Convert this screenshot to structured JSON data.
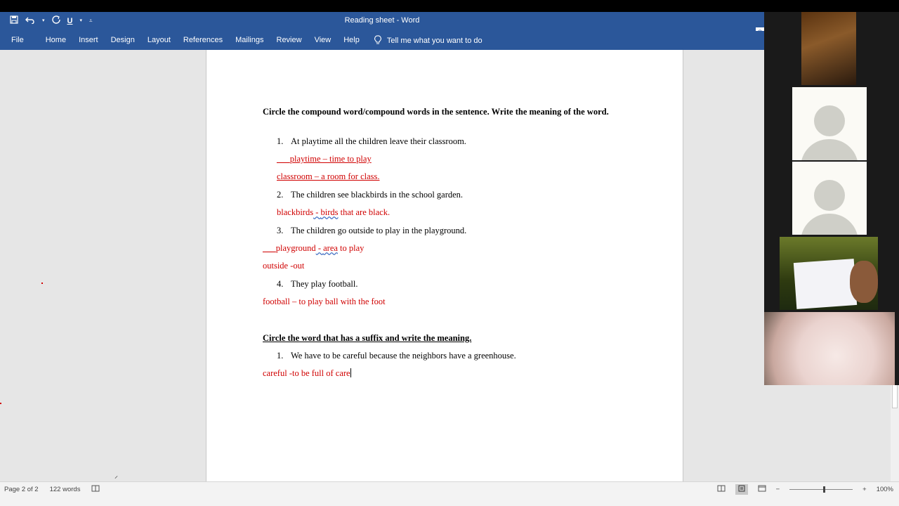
{
  "app": {
    "window_title": "Reading sheet  -  Word",
    "share_label": "S"
  },
  "quick_access": {
    "save_icon": "save-icon",
    "undo_icon": "undo-icon",
    "redo_icon": "redo-icon",
    "underline_label": "U"
  },
  "ribbon": {
    "tabs": [
      "File",
      "Home",
      "Insert",
      "Design",
      "Layout",
      "References",
      "Mailings",
      "Review",
      "View",
      "Help"
    ],
    "tell_me": "Tell me what you want to do"
  },
  "document": {
    "heading1": "Circle the compound word/compound words in the sentence. Write the meaning of the word.",
    "q1_num": "1.",
    "q1": "At playtime all the children leave their classroom.",
    "a1a_prefix": "___",
    "a1a": "playtime – time to play",
    "a1b": "classroom – a room for class.",
    "q2_num": "2.",
    "q2": "The children see blackbirds in the school garden.",
    "a2_a": "blackbirds",
    "a2_b": " -  ",
    "a2_c": "birds",
    "a2_d": " that are black.",
    "q3_num": "3.",
    "q3": "The children go outside to play in the playground.",
    "a3a_prefix": "___",
    "a3a_a": "playground",
    "a3a_b": " -  ",
    "a3a_c": "area",
    "a3a_d": " to play",
    "a3b": "outside -out",
    "q4_num": "4.",
    "q4": "They play football.",
    "a4": "football – to play ball with the foot",
    "heading2": "Circle the word that has a suffix and write the meaning.",
    "s1_num": "1.",
    "s1": "We have to be careful because the neighbors have a greenhouse.",
    "s1_answer": "careful -to be full of care"
  },
  "status": {
    "page": "Page 2 of 2",
    "words": "122 words",
    "zoom": "100%",
    "zoom_level_percent": 100
  },
  "participants": {
    "count": 5
  }
}
